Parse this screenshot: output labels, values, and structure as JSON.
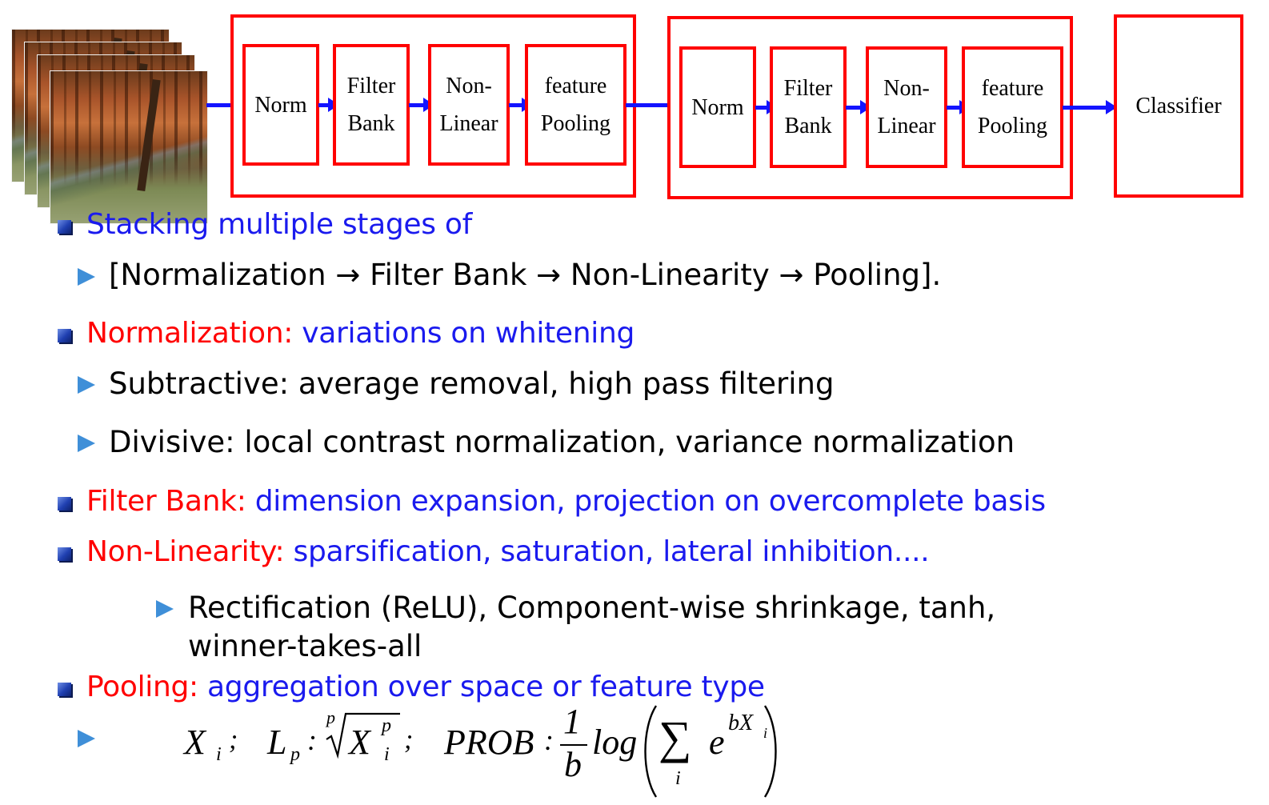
{
  "diagram": {
    "stage1": [
      "Norm",
      "Filter\nBank",
      "Non-\nLinear",
      "feature\nPooling"
    ],
    "stage2": [
      "Norm",
      "Filter\nBank",
      "Non-\nLinear",
      "feature\nPooling"
    ],
    "classifier": "Classifier",
    "colors": {
      "box_border": "#ff0000",
      "arrow": "#1414ff"
    }
  },
  "bullets": {
    "stacking": {
      "text": "Stacking multiple stages of"
    },
    "stacking_sub": "[Normalization → Filter Bank → Non-Linearity → Pooling].",
    "normalization": {
      "term": "Normalization:",
      "desc": " variations on whitening"
    },
    "norm_sub1": "Subtractive: average removal, high pass filtering",
    "norm_sub2": "Divisive: local contrast normalization, variance normalization",
    "filter_bank": {
      "term": "Filter Bank:",
      "desc": " dimension expansion, projection on overcomplete basis"
    },
    "non_linearity": {
      "term": "Non-Linearity:",
      "desc": " sparsification, saturation, lateral inhibition...."
    },
    "nl_sub_line1": "Rectification (ReLU), Component-wise shrinkage, tanh,",
    "nl_sub_line2": "winner-takes-all",
    "pooling": {
      "term": "Pooling:",
      "desc": " aggregation over space or feature type"
    }
  },
  "formula": {
    "x": "X",
    "i": "i",
    "sep": ";",
    "lp": "L",
    "p": "p",
    "colon": ":",
    "prob": "PROB",
    "one": "1",
    "b": "b",
    "log": "log",
    "sum": "∑",
    "e": "e",
    "bx": "bX"
  },
  "colors": {
    "term_red": "#ff0000",
    "desc_blue": "#1a1aee",
    "bullet_blue": "#1f3fb0",
    "sub_bullet": "#3f8fd8"
  }
}
